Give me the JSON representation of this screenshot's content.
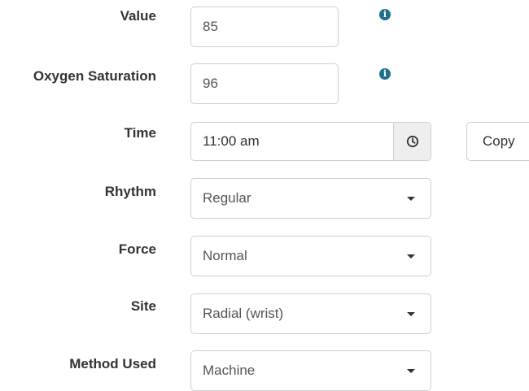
{
  "form": {
    "value": {
      "label": "Value",
      "input": "85"
    },
    "oxygen": {
      "label": "Oxygen Saturation",
      "input": "96"
    },
    "time": {
      "label": "Time",
      "input": "11:00 am",
      "copy_label": "Copy"
    },
    "rhythm": {
      "label": "Rhythm",
      "selected": "Regular"
    },
    "force": {
      "label": "Force",
      "selected": "Normal"
    },
    "site": {
      "label": "Site",
      "selected": "Radial (wrist)"
    },
    "method": {
      "label": "Method Used",
      "selected": "Machine"
    }
  },
  "icons": {
    "info": "info-icon",
    "clock": "clock-icon",
    "dropdown": "caret-down-icon"
  },
  "colors": {
    "info_icon": "#1f6f8f",
    "border": "#cfcfcf",
    "addon_bg": "#eeeeee"
  }
}
